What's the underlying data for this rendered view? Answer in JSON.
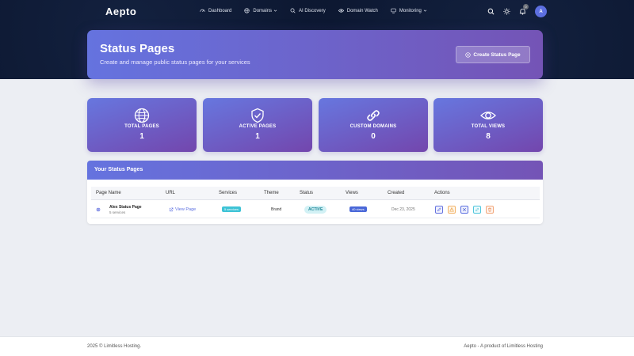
{
  "app": {
    "logo": "Aepto"
  },
  "nav": {
    "items": [
      {
        "label": "Dashboard",
        "icon": "dashboard-icon"
      },
      {
        "label": "Domains",
        "icon": "globe-icon",
        "dropdown": true
      },
      {
        "label": "AI Discovery",
        "icon": "search-icon"
      },
      {
        "label": "Domain Watch",
        "icon": "eye-icon"
      },
      {
        "label": "Monitoring",
        "icon": "monitor-icon",
        "dropdown": true
      }
    ],
    "notification_count": "0",
    "avatar_initial": "A"
  },
  "header": {
    "title": "Status Pages",
    "subtitle": "Create and manage public status pages for your services",
    "create_button": "Create Status Page"
  },
  "stats": [
    {
      "label": "TOTAL PAGES",
      "value": "1",
      "icon": "globe-icon"
    },
    {
      "label": "ACTIVE PAGES",
      "value": "1",
      "icon": "shield-check-icon"
    },
    {
      "label": "CUSTOM DOMAINS",
      "value": "0",
      "icon": "link-icon"
    },
    {
      "label": "TOTAL VIEWS",
      "value": "8",
      "icon": "eye-icon"
    }
  ],
  "table": {
    "title": "Your Status Pages",
    "columns": [
      "Page Name",
      "URL",
      "Services",
      "Theme",
      "Status",
      "Views",
      "Created",
      "Actions"
    ],
    "rows": [
      {
        "name": "Alex Status Page",
        "services_sub": "5 services",
        "url": "View Page",
        "services": "5 services",
        "theme": "Brand",
        "status": "ACTIVE",
        "views": "40 views",
        "created": "Dec 23, 2025"
      }
    ]
  },
  "footer": {
    "left": "2025 © Limitless Hosting.",
    "right": "Aepto - A product of Limitless Hosting"
  },
  "colors": {
    "navy": "#0c1730",
    "gradient_start": "#6573df",
    "gradient_end": "#7454b6",
    "accent_blue": "#5a6ee0"
  }
}
